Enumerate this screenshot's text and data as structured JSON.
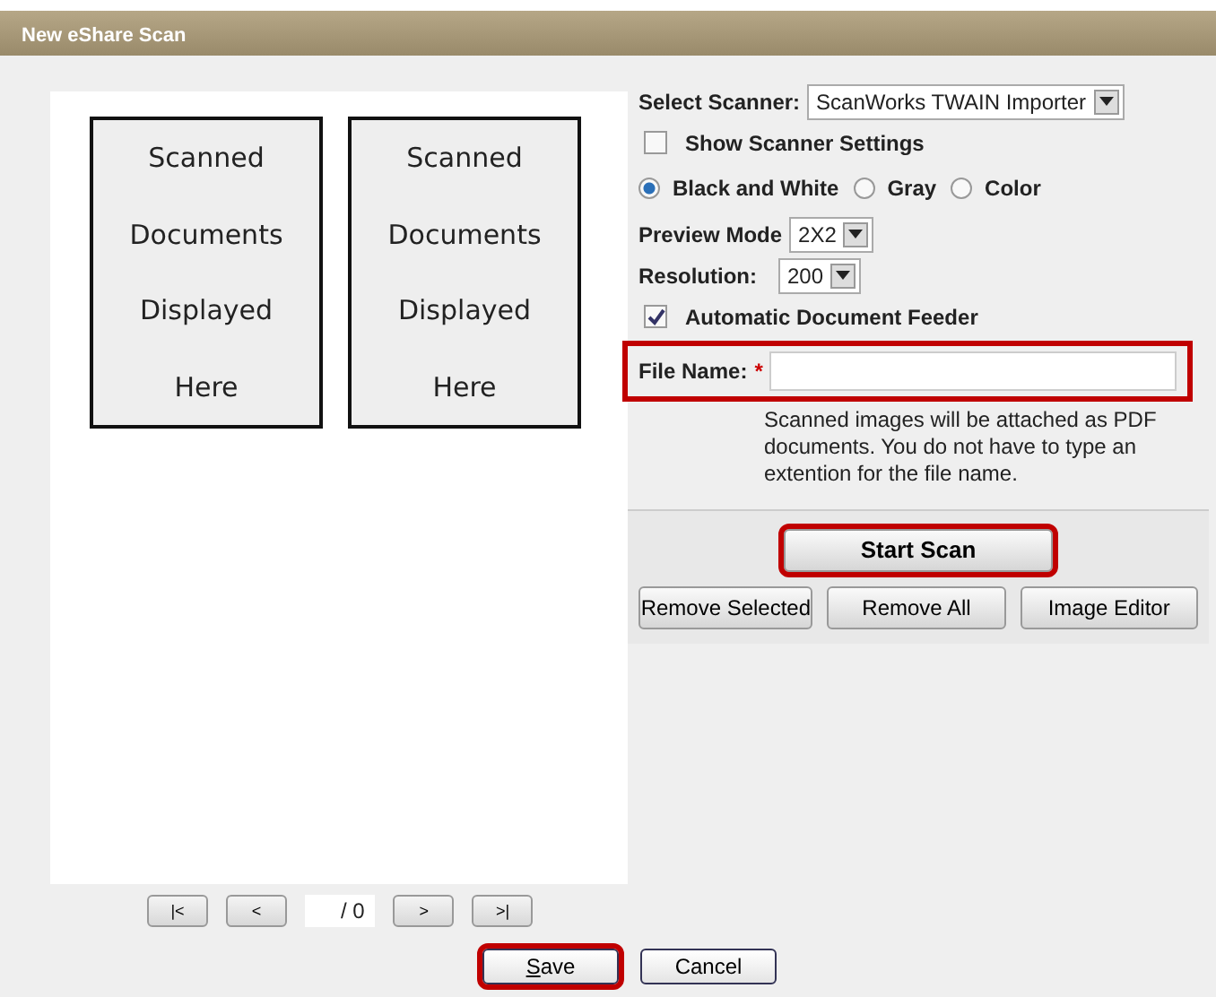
{
  "window": {
    "title": "New eShare Scan"
  },
  "preview": {
    "documents": [
      {
        "lines": [
          "Scanned",
          "Documents",
          "Displayed",
          "Here"
        ]
      },
      {
        "lines": [
          "Scanned",
          "Documents",
          "Displayed",
          "Here"
        ]
      }
    ],
    "pager": {
      "first": "|<",
      "prev": "<",
      "total": "/ 0",
      "next": ">",
      "last": ">|"
    }
  },
  "settings": {
    "scanner": {
      "label": "Select Scanner:",
      "value": "ScanWorks TWAIN Importer"
    },
    "show_settings": {
      "label": "Show Scanner Settings",
      "checked": false
    },
    "color_modes": [
      {
        "label": "Black and White",
        "selected": true
      },
      {
        "label": "Gray",
        "selected": false
      },
      {
        "label": "Color",
        "selected": false
      }
    ],
    "preview_mode": {
      "label": "Preview Mode",
      "value": "2X2"
    },
    "resolution": {
      "label": "Resolution:",
      "value": "200"
    },
    "feeder": {
      "label": "Automatic Document Feeder",
      "checked": true
    },
    "file_name": {
      "label": "File Name:",
      "required": "*",
      "highlighted": true
    },
    "hint": "Scanned images will be attached as PDF documents. You do not have to type an extention for the file name.",
    "start_scan": {
      "label": "Start Scan",
      "highlighted": true
    },
    "actions": [
      "Remove Selected",
      "Remove All",
      "Image Editor"
    ]
  },
  "footer": [
    {
      "label": "Save",
      "highlighted": true
    },
    {
      "label": "Cancel",
      "highlighted": false
    }
  ]
}
